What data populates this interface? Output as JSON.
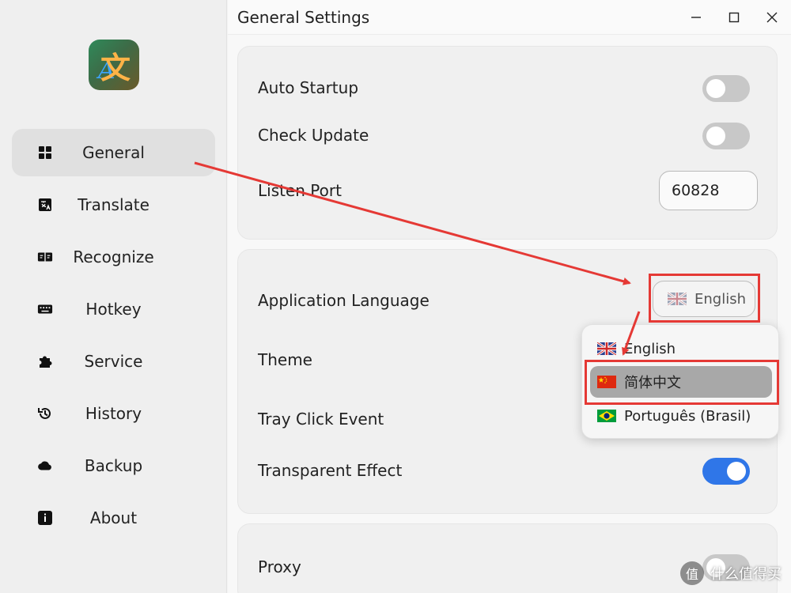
{
  "window": {
    "title": "General Settings"
  },
  "sidebar": {
    "items": [
      {
        "label": "General",
        "icon": "grid-icon",
        "active": true
      },
      {
        "label": "Translate",
        "icon": "translate-icon",
        "active": false
      },
      {
        "label": "Recognize",
        "icon": "recognize-icon",
        "active": false
      },
      {
        "label": "Hotkey",
        "icon": "keyboard-icon",
        "active": false
      },
      {
        "label": "Service",
        "icon": "puzzle-icon",
        "active": false
      },
      {
        "label": "History",
        "icon": "history-icon",
        "active": false
      },
      {
        "label": "Backup",
        "icon": "cloud-icon",
        "active": false
      },
      {
        "label": "About",
        "icon": "info-icon",
        "active": false
      }
    ]
  },
  "settings": {
    "auto_startup": {
      "label": "Auto Startup",
      "enabled": false
    },
    "check_update": {
      "label": "Check Update",
      "enabled": false
    },
    "listen_port": {
      "label": "Listen Port",
      "value": "60828"
    },
    "app_language": {
      "label": "Application Language",
      "value": "English"
    },
    "theme": {
      "label": "Theme"
    },
    "tray_click": {
      "label": "Tray Click Event"
    },
    "transparent": {
      "label": "Transparent Effect",
      "enabled": true
    },
    "proxy": {
      "label": "Proxy",
      "enabled": false
    }
  },
  "language_dropdown": {
    "options": [
      {
        "label": "English",
        "flag": "uk-flag-icon"
      },
      {
        "label": "简体中文",
        "flag": "china-flag-icon",
        "highlighted": true
      },
      {
        "label": "Português (Brasil)",
        "flag": "brazil-flag-icon"
      }
    ]
  },
  "watermark": {
    "text": "什么值得买",
    "badge": "值"
  },
  "colors": {
    "accent": "#2f76e8",
    "annotation": "#e53935",
    "active_nav": "#e0e0e0"
  }
}
